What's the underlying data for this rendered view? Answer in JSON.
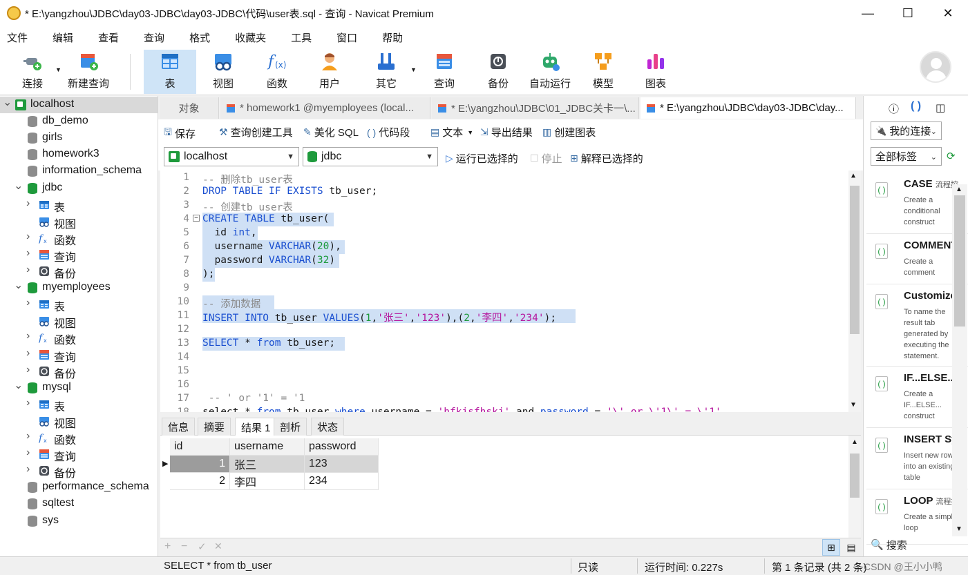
{
  "window": {
    "title": "* E:\\yangzhou\\JDBC\\day03-JDBC\\day03-JDBC\\代码\\user表.sql - 查询 - Navicat Premium",
    "minimize": "—",
    "maximize": "☐",
    "close": "✕"
  },
  "menu": [
    "文件",
    "编辑",
    "查看",
    "查询",
    "格式",
    "收藏夹",
    "工具",
    "窗口",
    "帮助"
  ],
  "toolbar": {
    "connect": "连接",
    "new_query": "新建查询",
    "table": "表",
    "view": "视图",
    "function": "函数",
    "user": "用户",
    "other": "其它",
    "query": "查询",
    "backup": "备份",
    "auto_run": "自动运行",
    "model": "模型",
    "chart": "图表"
  },
  "sidebar": {
    "items": [
      {
        "label": "localhost",
        "kind": "host"
      },
      {
        "label": "db_demo",
        "kind": "db"
      },
      {
        "label": "girls",
        "kind": "db"
      },
      {
        "label": "homework3",
        "kind": "db"
      },
      {
        "label": "information_schema",
        "kind": "db"
      },
      {
        "label": "jdbc",
        "kind": "db-open"
      },
      {
        "label": "表",
        "kind": "table"
      },
      {
        "label": "视图",
        "kind": "view"
      },
      {
        "label": "函数",
        "kind": "func"
      },
      {
        "label": "查询",
        "kind": "query"
      },
      {
        "label": "备份",
        "kind": "backup"
      },
      {
        "label": "myemployees",
        "kind": "db-open"
      },
      {
        "label": "表",
        "kind": "table"
      },
      {
        "label": "视图",
        "kind": "view"
      },
      {
        "label": "函数",
        "kind": "func"
      },
      {
        "label": "查询",
        "kind": "query"
      },
      {
        "label": "备份",
        "kind": "backup"
      },
      {
        "label": "mysql",
        "kind": "db-open"
      },
      {
        "label": "表",
        "kind": "table"
      },
      {
        "label": "视图",
        "kind": "view"
      },
      {
        "label": "函数",
        "kind": "func"
      },
      {
        "label": "查询",
        "kind": "query"
      },
      {
        "label": "备份",
        "kind": "backup"
      },
      {
        "label": "performance_schema",
        "kind": "db"
      },
      {
        "label": "sqltest",
        "kind": "db"
      },
      {
        "label": "sys",
        "kind": "db"
      }
    ]
  },
  "tabs": {
    "objects": "对象",
    "tab1": "* homework1 @myemployees (local...",
    "tab2": "* E:\\yangzhou\\JDBC\\01_JDBC关卡一\\...",
    "tab3": "* E:\\yangzhou\\JDBC\\day03-JDBC\\day..."
  },
  "query_toolbar": {
    "save": "保存",
    "query_builder": "查询创建工具",
    "beautify": "美化 SQL",
    "snippet": "代码段",
    "text": "文本",
    "export": "导出结果",
    "create_chart": "创建图表"
  },
  "connection": {
    "server": "localhost",
    "database": "jdbc",
    "run_selected": "运行已选择的",
    "stop": "停止",
    "explain": "解释已选择的"
  },
  "editor": {
    "line_numbers": [
      "1",
      "2",
      "3",
      "4",
      "5",
      "6",
      "7",
      "8",
      "9",
      "10",
      "11",
      "12",
      "13",
      "14",
      "15",
      "16",
      "17",
      "18"
    ],
    "lines": {
      "l1": "-- 删除tb_user表",
      "l2_a": "DROP TABLE IF EXISTS",
      "l2_b": " tb_user;",
      "l3": "-- 创建tb_user表",
      "l4_a": "CREATE TABLE",
      "l4_b": " tb_user(",
      "l5_a": "  id ",
      "l5_b": "int",
      "l5_c": ",",
      "l6_a": "  username ",
      "l6_b": "VARCHAR",
      "l6_c": "(",
      "l6_d": "20",
      "l6_e": "),",
      "l7_a": "  password ",
      "l7_b": "VARCHAR",
      "l7_c": "(",
      "l7_d": "32",
      "l7_e": ")",
      "l8": ");",
      "l10": "-- 添加数据",
      "l11_a": "INSERT INTO",
      "l11_b": " tb_user ",
      "l11_c": "VALUES",
      "l11_d": "(",
      "l11_e": "1",
      "l11_f": ",",
      "l11_g": "'张三'",
      "l11_h": ",",
      "l11_i": "'123'",
      "l11_j": "),(",
      "l11_k": "2",
      "l11_l": ",",
      "l11_m": "'李四'",
      "l11_n": ",",
      "l11_o": "'234'",
      "l11_p": ");",
      "l13_a": "SELECT",
      "l13_b": " * ",
      "l13_c": "from",
      "l13_d": " tb_user;",
      "l17": " -- ' or '1' = '1",
      "l18_a": "select * ",
      "l18_b": "from",
      "l18_c": " tb_user ",
      "l18_d": "where",
      "l18_e": " username = ",
      "l18_f": "'hfkjsfhskj'",
      "l18_g": " and ",
      "l18_h": "password",
      "l18_i": " = ",
      "l18_j": "'\\' or \\'1\\' = \\'1'"
    }
  },
  "result_tabs": [
    "信息",
    "摘要",
    "结果 1",
    "剖析",
    "状态"
  ],
  "results": {
    "columns": [
      "id",
      "username",
      "password"
    ],
    "rows": [
      [
        "1",
        "张三",
        "123"
      ],
      [
        "2",
        "李四",
        "234"
      ]
    ]
  },
  "grid_footer": {
    "add": "+",
    "remove": "−",
    "apply": "✓",
    "discard": "✕"
  },
  "status": {
    "sql": "SELECT * from tb_user",
    "readonly": "只读",
    "runtime": "运行时间: 0.227s",
    "records": "第 1 条记录 (共 2 条)",
    "watermark": "CSDN @王小小鸭"
  },
  "right_panel": {
    "my_connections": "我的连接",
    "all_tags": "全部标签",
    "search": "搜索",
    "snippets": [
      {
        "title": "CASE",
        "tag": "流程控",
        "desc": "Create a conditional construct"
      },
      {
        "title": "COMMENT",
        "tag": "",
        "desc": "Create a comment"
      },
      {
        "title": "Customize",
        "tag": "",
        "desc": "To name the result tab generated by executing the statement."
      },
      {
        "title": "IF...ELSE...",
        "tag": "",
        "desc": "Create a IF...ELSE... construct"
      },
      {
        "title": "INSERT Sy",
        "tag": "",
        "desc": "Insert new rows into an existing table"
      },
      {
        "title": "LOOP",
        "tag": "流程控",
        "desc": "Create a simple loop"
      }
    ]
  },
  "colors": {
    "accent": "#1a4fd0",
    "selection": "#cfe0f5",
    "active_tool": "#cfe4f7",
    "db_green": "#1e9a3c"
  }
}
